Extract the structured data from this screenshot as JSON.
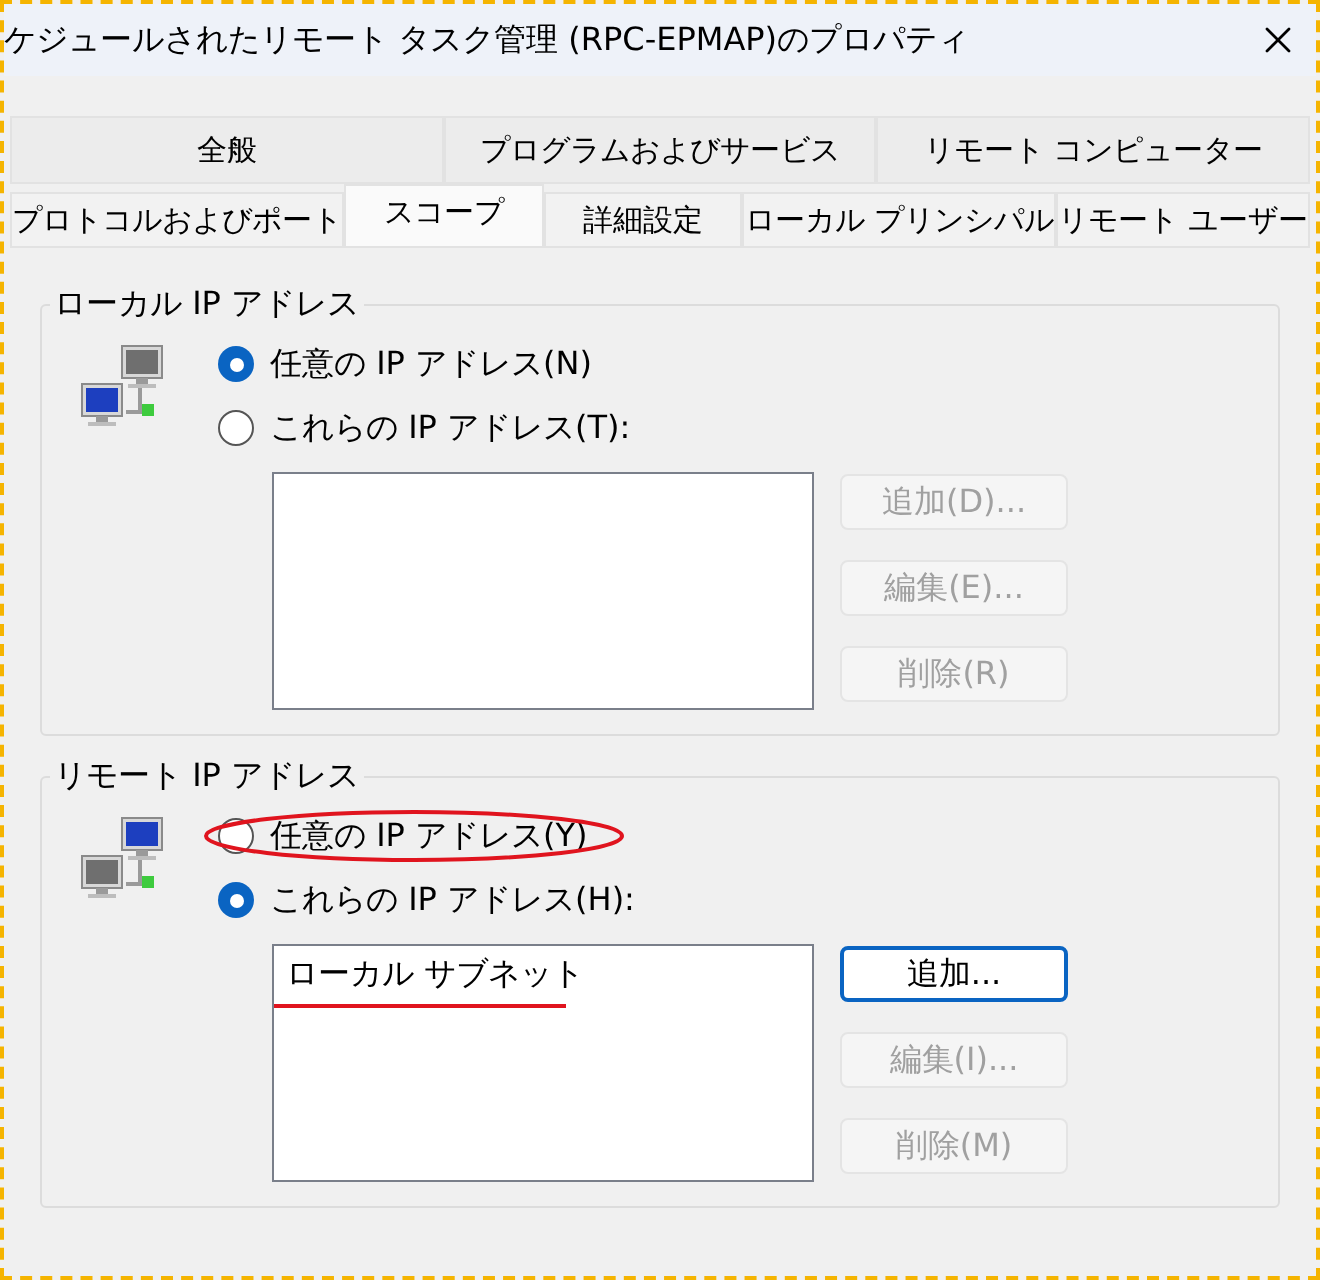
{
  "window": {
    "title": "ケジュールされたリモート タスク管理 (RPC-EPMAP)のプロパティ"
  },
  "tab_rows": [
    {
      "tabs": [
        {
          "label": "全般",
          "selected": false
        },
        {
          "label": "プログラムおよびサービス",
          "selected": false
        },
        {
          "label": "リモート コンピューター",
          "selected": false
        }
      ]
    },
    {
      "tabs": [
        {
          "label": "プロトコルおよびポート",
          "selected": false
        },
        {
          "label": "スコープ",
          "selected": true
        },
        {
          "label": "詳細設定",
          "selected": false
        },
        {
          "label": "ローカル プリンシパル",
          "selected": false
        },
        {
          "label": "リモート ユーザー",
          "selected": false
        }
      ]
    }
  ],
  "groups": [
    {
      "title": "ローカル IP アドレス",
      "kind": "local",
      "options": [
        {
          "label": "任意の IP アドレス(N)",
          "selected": true,
          "highlighted": false
        },
        {
          "label": "これらの IP アドレス(T):",
          "selected": false,
          "highlighted": false
        }
      ],
      "buttons": [
        {
          "label": "追加(D)...",
          "disabled": true
        },
        {
          "label": "編集(E)...",
          "disabled": true
        },
        {
          "label": "削除(R)",
          "disabled": true
        }
      ]
    },
    {
      "title": "リモート IP アドレス",
      "kind": "remote",
      "options": [
        {
          "label": "任意の IP アドレス(Y)",
          "selected": false,
          "highlighted": true
        },
        {
          "label": "これらの IP アドレス(H):",
          "selected": true,
          "highlighted": false
        }
      ],
      "list_items": [
        {
          "label": "ローカル サブネット",
          "underlined": true
        }
      ],
      "buttons": [
        {
          "label": "追加...",
          "disabled": false
        },
        {
          "label": "編集(I)...",
          "disabled": true
        },
        {
          "label": "削除(M)",
          "disabled": true
        }
      ]
    }
  ]
}
